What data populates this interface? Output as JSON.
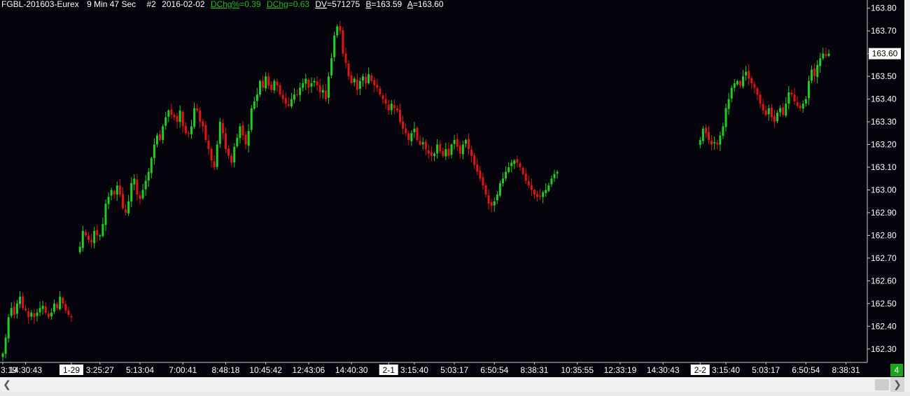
{
  "header": {
    "symbol": "FGBL-201603-Eurex",
    "interval": "9 Min 47 Sec",
    "chart_no": "#2",
    "date": "2016-02-02",
    "dchg_pct_label": "DChg%",
    "dchg_pct_value": "0.39",
    "dchg_label": "DChg",
    "dchg_value": "0.63",
    "dv_label": "DV",
    "dv_value": "571275",
    "bid_label": "B",
    "bid_value": "163.59",
    "ask_label": "A",
    "ask_value": "163.60"
  },
  "badge": "4",
  "colors": {
    "background": "#05040c",
    "up": "#22cc22",
    "down": "#dd1515",
    "axis_text": "#ffffff",
    "header_green": "#22bb22"
  },
  "chart_data": {
    "type": "candlestick",
    "ylim": [
      162.25,
      163.83
    ],
    "y_ticks": [
      162.3,
      162.4,
      162.5,
      162.6,
      162.7,
      162.8,
      162.9,
      163.0,
      163.1,
      163.2,
      163.3,
      163.4,
      163.5,
      163.6,
      163.7,
      163.8
    ],
    "last_price": "163.60",
    "x_tick_labels": [
      {
        "label": "3:19",
        "index": 0,
        "day_marker": false
      },
      {
        "label": "14:30:43",
        "index": 8,
        "day_marker": false
      },
      {
        "label": "1-29",
        "index": 24,
        "day_marker": true
      },
      {
        "label": "3:25:27",
        "index": 34,
        "day_marker": false
      },
      {
        "label": "5:13:04",
        "index": 48,
        "day_marker": false
      },
      {
        "label": "7:00:41",
        "index": 63,
        "day_marker": false
      },
      {
        "label": "8:48:18",
        "index": 78,
        "day_marker": false
      },
      {
        "label": "10:45:42",
        "index": 92,
        "day_marker": false
      },
      {
        "label": "12:43:06",
        "index": 107,
        "day_marker": false
      },
      {
        "label": "14:40:30",
        "index": 122,
        "day_marker": false
      },
      {
        "label": "2-1",
        "index": 135,
        "day_marker": true
      },
      {
        "label": "3:15:40",
        "index": 144,
        "day_marker": false
      },
      {
        "label": "5:03:17",
        "index": 158,
        "day_marker": false
      },
      {
        "label": "6:50:54",
        "index": 172,
        "day_marker": false
      },
      {
        "label": "8:38:31",
        "index": 186,
        "day_marker": false
      },
      {
        "label": "10:35:55",
        "index": 201,
        "day_marker": false
      },
      {
        "label": "12:33:19",
        "index": 216,
        "day_marker": false
      },
      {
        "label": "14:30:43",
        "index": 231,
        "day_marker": false
      },
      {
        "label": "2-2",
        "index": 244,
        "day_marker": true
      },
      {
        "label": "3:15:40",
        "index": 253,
        "day_marker": false
      },
      {
        "label": "5:03:17",
        "index": 267,
        "day_marker": false
      },
      {
        "label": "6:50:54",
        "index": 281,
        "day_marker": false
      },
      {
        "label": "8:38:31",
        "index": 295,
        "day_marker": false
      }
    ],
    "segments": [
      {
        "start_index": 0,
        "prices": [
          162.28,
          162.35,
          162.44,
          162.48,
          162.45,
          162.5,
          162.53,
          162.48,
          162.47,
          162.44,
          162.46,
          162.44,
          162.46,
          162.48,
          162.49,
          162.46,
          162.44,
          162.46,
          162.5,
          162.48,
          162.53,
          162.5,
          162.47,
          162.45,
          162.44
        ]
      },
      {
        "start_index": 27,
        "prices": [
          162.75,
          162.82,
          162.8,
          162.78,
          162.77,
          162.82,
          162.8,
          162.8,
          162.85,
          162.94,
          162.97,
          163.0,
          162.98,
          163.02,
          162.98,
          162.92,
          162.9,
          162.95,
          163.03,
          163.05,
          162.98,
          162.96,
          163.0,
          163.04,
          163.08,
          163.14,
          163.2,
          163.24,
          163.22,
          163.28,
          163.32,
          163.35,
          163.33,
          163.32,
          163.3,
          163.35,
          163.28,
          163.25,
          163.25,
          163.28,
          163.36,
          163.35,
          163.3,
          163.28,
          163.22,
          163.18,
          163.13,
          163.1,
          163.2,
          163.3,
          163.25,
          163.18,
          163.15,
          163.12,
          163.19,
          163.23,
          163.28,
          163.24,
          163.2,
          163.26,
          163.36,
          163.39,
          163.42,
          163.48,
          163.45,
          163.5,
          163.46,
          163.44,
          163.48,
          163.46,
          163.42,
          163.4,
          163.38,
          163.37,
          163.4,
          163.42,
          163.42,
          163.45,
          163.47,
          163.49,
          163.45,
          163.47,
          163.48,
          163.46,
          163.43,
          163.44,
          163.4,
          163.5,
          163.58,
          163.68,
          163.72,
          163.7,
          163.6,
          163.56,
          163.5,
          163.47,
          163.49,
          163.44,
          163.48,
          163.5,
          163.47,
          163.51,
          163.48,
          163.46,
          163.45,
          163.42,
          163.4,
          163.38,
          163.35,
          163.38,
          163.36,
          163.35,
          163.3,
          163.27,
          163.25,
          163.22,
          163.25,
          163.27,
          163.22,
          163.2,
          163.21,
          163.18,
          163.16,
          163.15,
          163.16,
          163.2,
          163.17,
          163.15,
          163.18,
          163.15,
          163.2,
          163.22,
          163.19,
          163.16,
          163.2,
          163.22,
          163.18,
          163.15,
          163.11,
          163.08,
          163.05,
          163.02,
          162.98,
          162.94,
          162.93,
          162.95,
          162.98,
          163.03,
          163.05,
          163.08,
          163.1,
          163.12,
          163.13,
          163.12,
          163.1,
          163.07,
          163.04,
          163.02,
          163.0,
          162.98,
          162.97,
          162.97,
          162.99,
          163.0,
          163.02,
          163.05,
          163.07,
          163.08
        ]
      },
      {
        "start_index": 244,
        "prices": [
          163.22,
          163.27,
          163.25,
          163.22,
          163.2,
          163.21,
          163.2,
          163.24,
          163.28,
          163.36,
          163.4,
          163.45,
          163.47,
          163.48,
          163.46,
          163.5,
          163.52,
          163.49,
          163.47,
          163.45,
          163.42,
          163.38,
          163.35,
          163.33,
          163.36,
          163.32,
          163.3,
          163.34,
          163.36,
          163.33,
          163.38,
          163.43,
          163.42,
          163.39,
          163.37,
          163.36,
          163.38,
          163.4,
          163.48,
          163.53,
          163.5,
          163.55,
          163.58,
          163.6,
          163.59,
          163.6
        ]
      }
    ]
  }
}
